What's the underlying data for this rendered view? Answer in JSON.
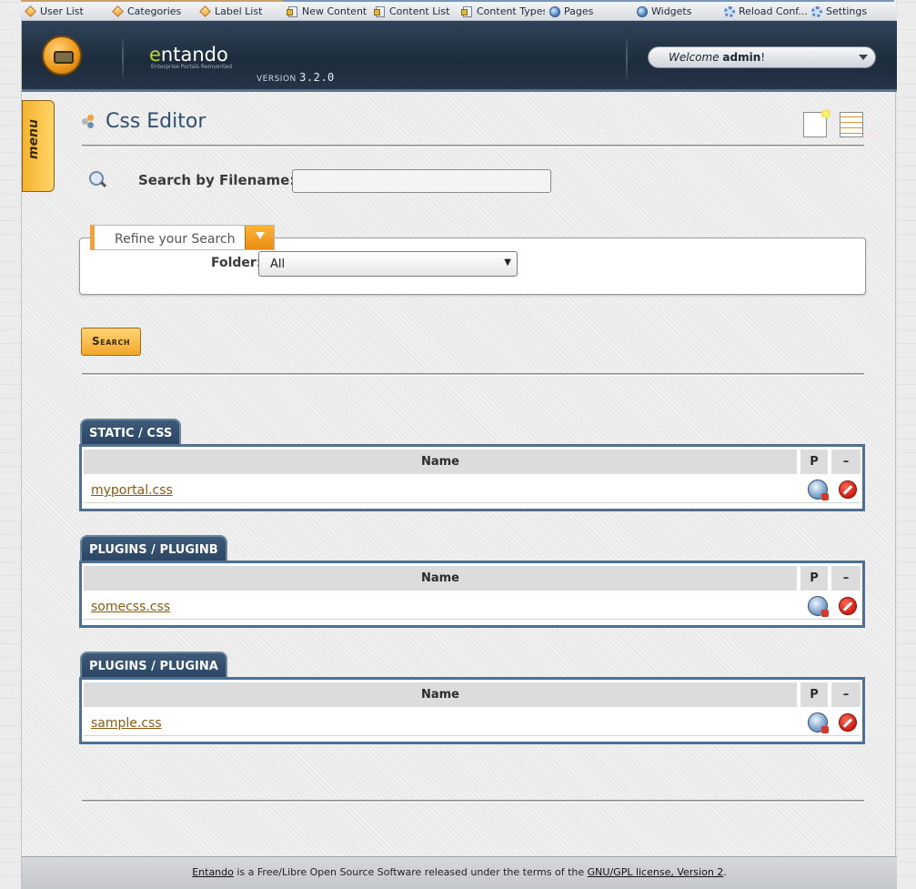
{
  "shortcuts": [
    {
      "label": "User List",
      "icon": "diamond-icon"
    },
    {
      "label": "Categories",
      "icon": "diamond-icon"
    },
    {
      "label": "Label List",
      "icon": "diamond-icon"
    },
    {
      "label": "New Content",
      "icon": "document-icon"
    },
    {
      "label": "Content List",
      "icon": "document-icon"
    },
    {
      "label": "Content Types",
      "icon": "document-icon"
    },
    {
      "label": "Pages",
      "icon": "globe-icon"
    },
    {
      "label": "Widgets",
      "icon": "globe-icon"
    },
    {
      "label": "Reload Conf...",
      "icon": "gear-icon"
    },
    {
      "label": "Settings",
      "icon": "gear-icon"
    }
  ],
  "header": {
    "logo_e": "e",
    "logo_rest": "ntando",
    "tagline": "Enterprise Portals Reinvented",
    "version_label": "VERSION",
    "version": "3.2.0",
    "welcome_prefix": "Welcome",
    "username": "admin",
    "welcome_suffix": "!"
  },
  "menu_tab": "menu",
  "page_title": "Css Editor",
  "search": {
    "label": "Search by Filename:",
    "value": "",
    "refine_label": "Refine your Search",
    "folder_label": "Folder:",
    "folder_value": "All",
    "button_label": "Search"
  },
  "groups": [
    {
      "title": "STATIC / CSS",
      "col_name": "Name",
      "col_p": "P",
      "col_del": "–",
      "files": [
        "myportal.css"
      ]
    },
    {
      "title": "PLUGINS / PLUGINB",
      "col_name": "Name",
      "col_p": "P",
      "col_del": "–",
      "files": [
        "somecss.css"
      ]
    },
    {
      "title": "PLUGINS / PLUGINA",
      "col_name": "Name",
      "col_p": "P",
      "col_del": "–",
      "files": [
        "sample.css"
      ]
    }
  ],
  "footer": {
    "link1": "Entando",
    "text1": " is a Free/Libre Open Source Software released under the terms of the ",
    "link2": "GNU/GPL license, Version 2",
    "text2": "."
  },
  "colors": {
    "accent": "#f0a23a",
    "header": "#1d2c3c",
    "group_border": "#4e6e92",
    "link": "#8b5a12"
  }
}
